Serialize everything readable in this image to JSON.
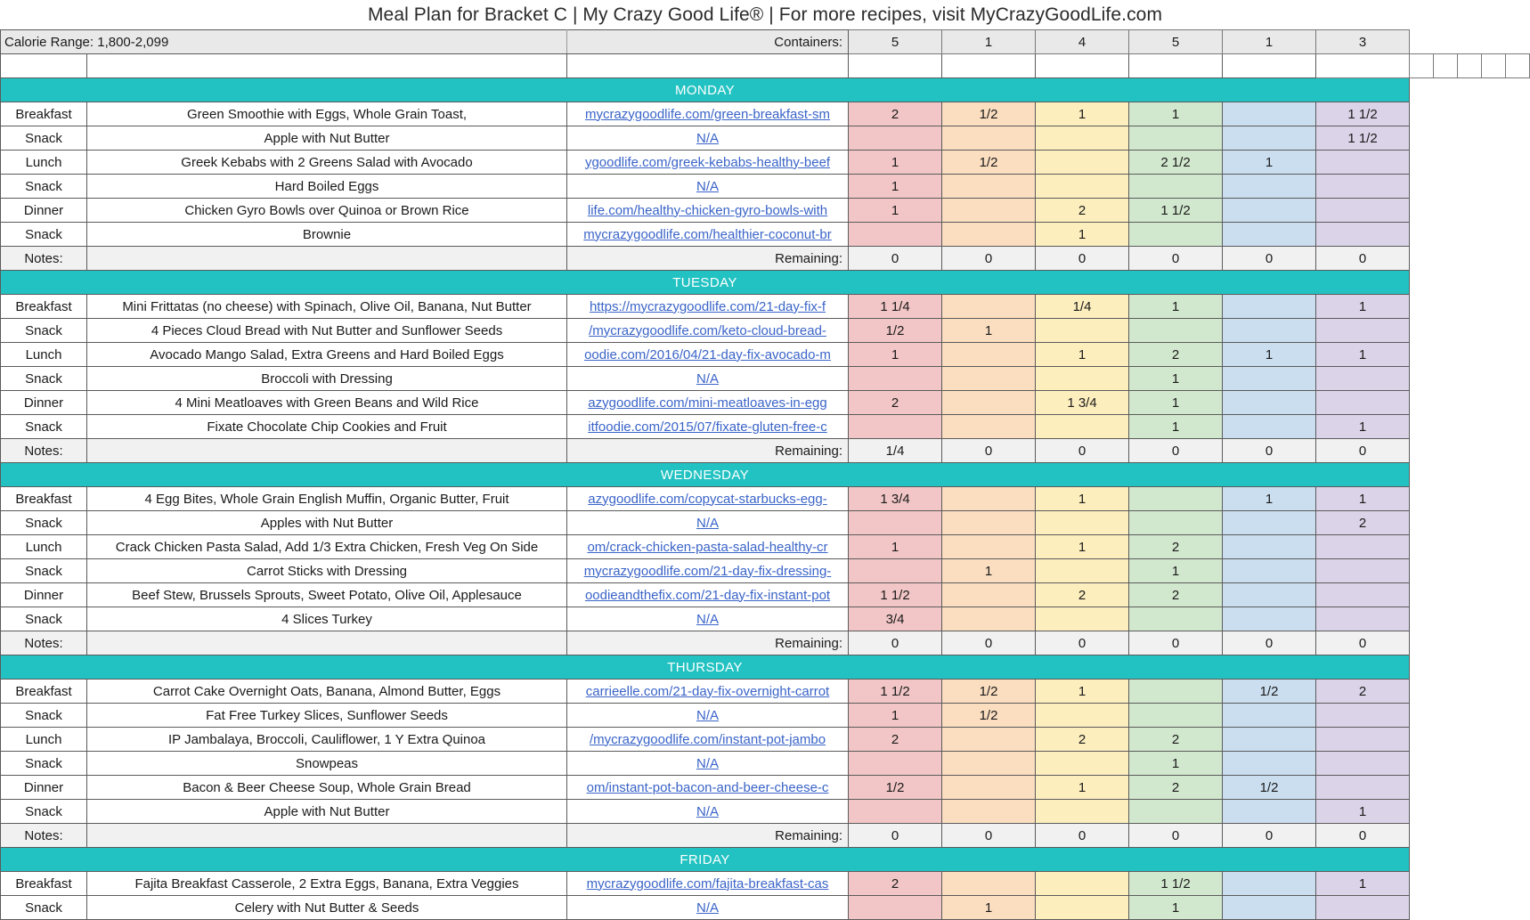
{
  "title": "Meal Plan for Bracket C | My Crazy Good Life® | For more recipes, visit MyCrazyGoodLife.com",
  "header": {
    "calorie_label": "Calorie Range: 1,800-2,099",
    "containers_label": "Containers:",
    "container_totals": [
      "5",
      "1",
      "4",
      "5",
      "1",
      "3"
    ],
    "container_colors": [
      "#f2c6c6",
      "#fbddc0",
      "#fdeebe",
      "#d2e8ce",
      "#cadef0",
      "#dbd3e8"
    ]
  },
  "labels": {
    "notes": "Notes:",
    "remaining": "Remaining:",
    "na": "N/A"
  },
  "days": [
    {
      "name": "MONDAY",
      "rows": [
        {
          "meal": "Breakfast",
          "food": "Green Smoothie with Eggs, Whole Grain Toast,",
          "link": "mycrazygoodlife.com/green-breakfast-sm",
          "vals": [
            "2",
            "1/2",
            "1",
            "1",
            "",
            "1 1/2"
          ]
        },
        {
          "meal": "Snack",
          "food": "Apple with Nut Butter",
          "link": "N/A",
          "vals": [
            "",
            "",
            "",
            "",
            "",
            "1 1/2"
          ]
        },
        {
          "meal": "Lunch",
          "food": "Greek Kebabs with 2 Greens Salad with Avocado",
          "link": "ygoodlife.com/greek-kebabs-healthy-beef",
          "vals": [
            "1",
            "1/2",
            "",
            "2 1/2",
            "1",
            ""
          ]
        },
        {
          "meal": "Snack",
          "food": "Hard Boiled Eggs",
          "link": "N/A",
          "vals": [
            "1",
            "",
            "",
            "",
            "",
            ""
          ]
        },
        {
          "meal": "Dinner",
          "food": "Chicken Gyro Bowls over Quinoa or Brown Rice",
          "link": "life.com/healthy-chicken-gyro-bowls-with",
          "vals": [
            "1",
            "",
            "2",
            "1 1/2",
            "",
            ""
          ]
        },
        {
          "meal": "Snack",
          "food": "Brownie",
          "link": "mycrazygoodlife.com/healthier-coconut-br",
          "vals": [
            "",
            "",
            "1",
            "",
            "",
            ""
          ]
        }
      ],
      "remaining": [
        "0",
        "0",
        "0",
        "0",
        "0",
        "0"
      ]
    },
    {
      "name": "TUESDAY",
      "rows": [
        {
          "meal": "Breakfast",
          "food": "Mini Frittatas (no cheese) with Spinach, Olive Oil, Banana, Nut Butter",
          "link": "https://mycrazygoodlife.com/21-day-fix-f",
          "vals": [
            "1 1/4",
            "",
            "1/4",
            "1",
            "",
            "1"
          ]
        },
        {
          "meal": "Snack",
          "food": "4 Pieces Cloud Bread with Nut Butter and Sunflower Seeds",
          "link": "/mycrazygoodlife.com/keto-cloud-bread-",
          "vals": [
            "1/2",
            "1",
            "",
            "",
            "",
            ""
          ]
        },
        {
          "meal": "Lunch",
          "food": "Avocado Mango Salad, Extra Greens and Hard Boiled Eggs",
          "link": "oodie.com/2016/04/21-day-fix-avocado-m",
          "vals": [
            "1",
            "",
            "1",
            "2",
            "1",
            "1"
          ]
        },
        {
          "meal": "Snack",
          "food": "Broccoli with Dressing",
          "link": "N/A",
          "vals": [
            "",
            "",
            "",
            "1",
            "",
            ""
          ]
        },
        {
          "meal": "Dinner",
          "food": "4 Mini Meatloaves with Green Beans and Wild Rice",
          "link": "azygoodlife.com/mini-meatloaves-in-egg",
          "vals": [
            "2",
            "",
            "1 3/4",
            "1",
            "",
            ""
          ]
        },
        {
          "meal": "Snack",
          "food": "Fixate Chocolate Chip Cookies and Fruit",
          "link": "itfoodie.com/2015/07/fixate-gluten-free-c",
          "vals": [
            "",
            "",
            "",
            "1",
            "",
            "1"
          ]
        }
      ],
      "remaining": [
        "1/4",
        "0",
        "0",
        "0",
        "0",
        "0"
      ]
    },
    {
      "name": "WEDNESDAY",
      "rows": [
        {
          "meal": "Breakfast",
          "food": "4 Egg Bites, Whole Grain English Muffin, Organic Butter, Fruit",
          "link": "azygoodlife.com/copycat-starbucks-egg-",
          "vals": [
            "1 3/4",
            "",
            "1",
            "",
            "1",
            "1"
          ]
        },
        {
          "meal": "Snack",
          "food": "Apples with Nut Butter",
          "link": "N/A",
          "vals": [
            "",
            "",
            "",
            "",
            "",
            "2"
          ]
        },
        {
          "meal": "Lunch",
          "food": "Crack Chicken Pasta Salad, Add 1/3 Extra Chicken, Fresh Veg On Side",
          "link": "om/crack-chicken-pasta-salad-healthy-cr",
          "vals": [
            "1",
            "",
            "1",
            "2",
            "",
            ""
          ]
        },
        {
          "meal": "Snack",
          "food": "Carrot Sticks with Dressing",
          "link": "mycrazygoodlife.com/21-day-fix-dressing-",
          "vals": [
            "",
            "1",
            "",
            "1",
            "",
            ""
          ]
        },
        {
          "meal": "Dinner",
          "food": "Beef Stew, Brussels Sprouts, Sweet Potato, Olive Oil, Applesauce",
          "link": "oodieandthefix.com/21-day-fix-instant-pot",
          "vals": [
            "1 1/2",
            "",
            "2",
            "2",
            "",
            ""
          ]
        },
        {
          "meal": "Snack",
          "food": "4 Slices Turkey",
          "link": "N/A",
          "vals": [
            "3/4",
            "",
            "",
            "",
            "",
            ""
          ]
        }
      ],
      "remaining": [
        "0",
        "0",
        "0",
        "0",
        "0",
        "0"
      ]
    },
    {
      "name": "THURSDAY",
      "rows": [
        {
          "meal": "Breakfast",
          "food": "Carrot Cake Overnight Oats, Banana, Almond Butter, Eggs",
          "link": "carrieelle.com/21-day-fix-overnight-carrot",
          "vals": [
            "1 1/2",
            "1/2",
            "1",
            "",
            "1/2",
            "2"
          ]
        },
        {
          "meal": "Snack",
          "food": "Fat Free Turkey Slices, Sunflower Seeds",
          "link": "N/A",
          "vals": [
            "1",
            "1/2",
            "",
            "",
            "",
            ""
          ]
        },
        {
          "meal": "Lunch",
          "food": "IP Jambalaya, Broccoli, Cauliflower, 1 Y Extra Quinoa",
          "link": "/mycrazygoodlife.com/instant-pot-jambo",
          "vals": [
            "2",
            "",
            "2",
            "2",
            "",
            ""
          ]
        },
        {
          "meal": "Snack",
          "food": "Snowpeas",
          "link": "N/A",
          "vals": [
            "",
            "",
            "",
            "1",
            "",
            ""
          ]
        },
        {
          "meal": "Dinner",
          "food": "Bacon & Beer Cheese Soup, Whole Grain Bread",
          "link": "om/instant-pot-bacon-and-beer-cheese-c",
          "vals": [
            "1/2",
            "",
            "1",
            "2",
            "1/2",
            ""
          ]
        },
        {
          "meal": "Snack",
          "food": "Apple with Nut Butter",
          "link": "N/A",
          "vals": [
            "",
            "",
            "",
            "",
            "",
            "1"
          ]
        }
      ],
      "remaining": [
        "0",
        "0",
        "0",
        "0",
        "0",
        "0"
      ]
    },
    {
      "name": "FRIDAY",
      "rows": [
        {
          "meal": "Breakfast",
          "food": "Fajita Breakfast Casserole, 2 Extra Eggs, Banana, Extra Veggies",
          "link": "mycrazygoodlife.com/fajita-breakfast-cas",
          "vals": [
            "2",
            "",
            "",
            "1 1/2",
            "",
            "1"
          ]
        },
        {
          "meal": "Snack",
          "food": "Celery with Nut Butter & Seeds",
          "link": "N/A",
          "vals": [
            "",
            "1",
            "",
            "1",
            "",
            ""
          ]
        }
      ],
      "remaining": []
    }
  ]
}
